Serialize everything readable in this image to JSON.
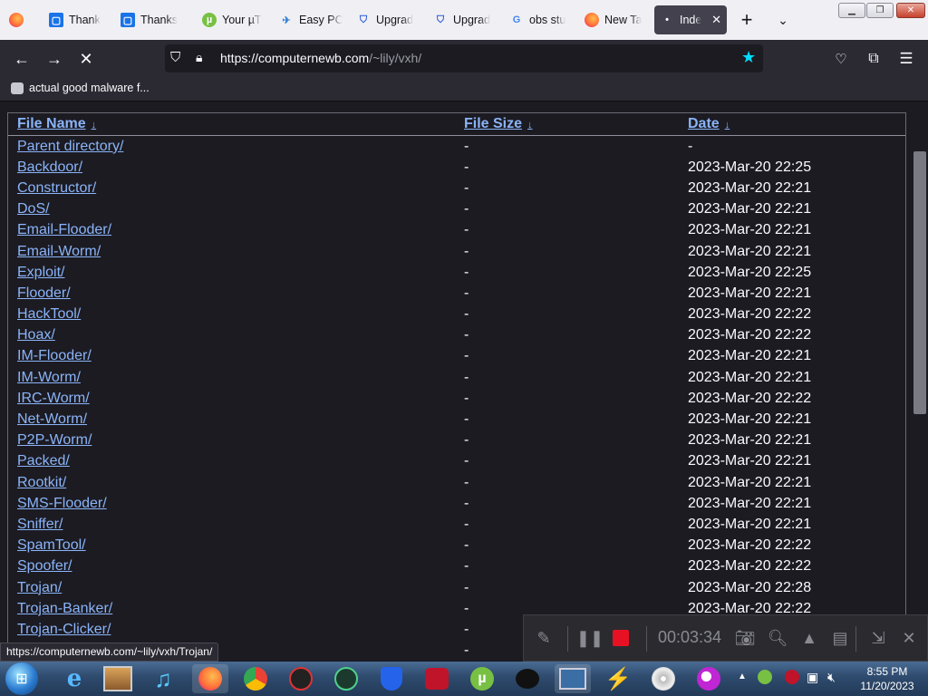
{
  "browser": {
    "tabs": [
      {
        "label": "Thank",
        "icon": "microsoft-edge-icon"
      },
      {
        "label": "Thanks",
        "icon": "microsoft-edge-icon"
      },
      {
        "label": "Your µT",
        "icon": "utorrent-icon"
      },
      {
        "label": "Easy PC",
        "icon": "wrench-icon"
      },
      {
        "label": "Upgrad",
        "icon": "shield-icon"
      },
      {
        "label": "Upgrad",
        "icon": "shield-icon"
      },
      {
        "label": "obs stu",
        "icon": "google-icon"
      },
      {
        "label": "New Ta",
        "icon": "firefox-icon"
      },
      {
        "label": "Inde",
        "icon": "dot-icon",
        "active": true
      }
    ],
    "url_domain": "https://computernewb.com",
    "url_path": "/~lily/vxh/",
    "bookmark": "actual good malware f...",
    "status_url": "https://computernewb.com/~lily/vxh/Trojan/"
  },
  "listing": {
    "headers": {
      "name": "File Name",
      "size": "File Size",
      "date": "Date",
      "sort_icon": "↓"
    },
    "rows": [
      {
        "name": "Parent directory/",
        "size": "-",
        "date": "-"
      },
      {
        "name": "Backdoor/",
        "size": "-",
        "date": "2023-Mar-20 22:25"
      },
      {
        "name": "Constructor/",
        "size": "-",
        "date": "2023-Mar-20 22:21"
      },
      {
        "name": "DoS/",
        "size": "-",
        "date": "2023-Mar-20 22:21"
      },
      {
        "name": "Email-Flooder/",
        "size": "-",
        "date": "2023-Mar-20 22:21"
      },
      {
        "name": "Email-Worm/",
        "size": "-",
        "date": "2023-Mar-20 22:21"
      },
      {
        "name": "Exploit/",
        "size": "-",
        "date": "2023-Mar-20 22:25"
      },
      {
        "name": "Flooder/",
        "size": "-",
        "date": "2023-Mar-20 22:21"
      },
      {
        "name": "HackTool/",
        "size": "-",
        "date": "2023-Mar-20 22:22"
      },
      {
        "name": "Hoax/",
        "size": "-",
        "date": "2023-Mar-20 22:22"
      },
      {
        "name": "IM-Flooder/",
        "size": "-",
        "date": "2023-Mar-20 22:21"
      },
      {
        "name": "IM-Worm/",
        "size": "-",
        "date": "2023-Mar-20 22:21"
      },
      {
        "name": "IRC-Worm/",
        "size": "-",
        "date": "2023-Mar-20 22:22"
      },
      {
        "name": "Net-Worm/",
        "size": "-",
        "date": "2023-Mar-20 22:21"
      },
      {
        "name": "P2P-Worm/",
        "size": "-",
        "date": "2023-Mar-20 22:21"
      },
      {
        "name": "Packed/",
        "size": "-",
        "date": "2023-Mar-20 22:21"
      },
      {
        "name": "Rootkit/",
        "size": "-",
        "date": "2023-Mar-20 22:21"
      },
      {
        "name": "SMS-Flooder/",
        "size": "-",
        "date": "2023-Mar-20 22:21"
      },
      {
        "name": "Sniffer/",
        "size": "-",
        "date": "2023-Mar-20 22:21"
      },
      {
        "name": "SpamTool/",
        "size": "-",
        "date": "2023-Mar-20 22:22"
      },
      {
        "name": "Spoofer/",
        "size": "-",
        "date": "2023-Mar-20 22:22"
      },
      {
        "name": "Trojan/",
        "size": "-",
        "date": "2023-Mar-20 22:28"
      },
      {
        "name": "Trojan-Banker/",
        "size": "-",
        "date": "2023-Mar-20 22:22"
      },
      {
        "name": "Trojan-Clicker/",
        "size": "-",
        "date": ""
      },
      {
        "name": "",
        "size": "-",
        "date": ""
      }
    ]
  },
  "recorder": {
    "timer": "00:03:34"
  },
  "taskbar": {
    "time": "8:55 PM",
    "date": "11/20/2023"
  },
  "colors": {
    "link": "#8ab4f8",
    "page_bg": "#1c1b22",
    "toolbar_bg": "#2b2a33",
    "record_red": "#e81123",
    "bookmark_star": "#0df"
  }
}
